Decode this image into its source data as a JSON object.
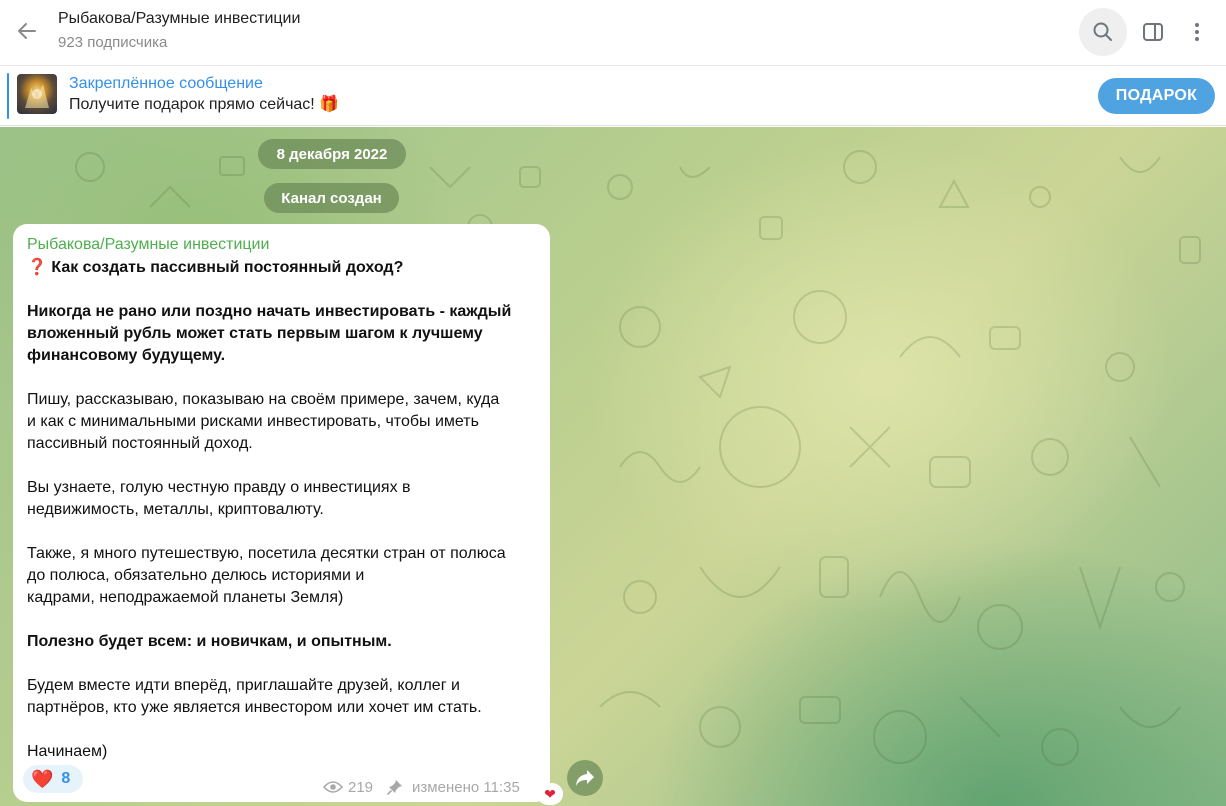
{
  "header": {
    "title": "Рыбакова/Разумные инвестиции",
    "subtitle": "923 подписчика",
    "icons": {
      "back": "back-arrow-icon",
      "search": "search-icon",
      "sidebar": "sidebar-toggle-icon",
      "more": "more-vertical-icon"
    }
  },
  "pinned": {
    "title": "Закреплённое сообщение",
    "text": "Получите подарок прямо сейчас! 🎁",
    "button_label": "ПОДАРОК"
  },
  "chat": {
    "date_label": "8 декабря 2022",
    "service_label": "Канал создан",
    "message": {
      "sender": "Рыбакова/Разумные инвестиции",
      "title": "❓ Как создать пассивный постоянный доход?",
      "p1": "Никогда не рано или поздно начать инвестировать - каждый\nвложенный рубль может стать первым шагом к лучшему\nфинансовому будущему.",
      "p2": "Пишу, рассказываю, показываю на своём примере, зачем, куда\nи как с минимальными рисками инвестировать, чтобы иметь\nпассивный постоянный доход.",
      "p3": "Вы узнаете, голую честную правду о инвестициях в\nнедвижимость, металлы, криптовалюту.",
      "p4": "Также, я много путешествую, посетила десятки стран от полюса\nдо полюса, обязательно делюсь историями и\nкадрами, неподражаемой планеты Земля)",
      "p5": "Полезно будет всем: и новичкам, и опытным.",
      "p6": "Будем вместе идти вперёд, приглашайте друзей, коллег и\nпартнёров, кто уже является инвестором или хочет им стать.",
      "p7": "Начинаем)",
      "reaction_emoji": "❤️",
      "reaction_count": "8",
      "views": "219",
      "edited": "изменено 11:35"
    }
  },
  "colors": {
    "accent": "#3390ec",
    "sender": "#4fae4e",
    "button": "#4fa3e0",
    "heart": "#e0243b"
  }
}
